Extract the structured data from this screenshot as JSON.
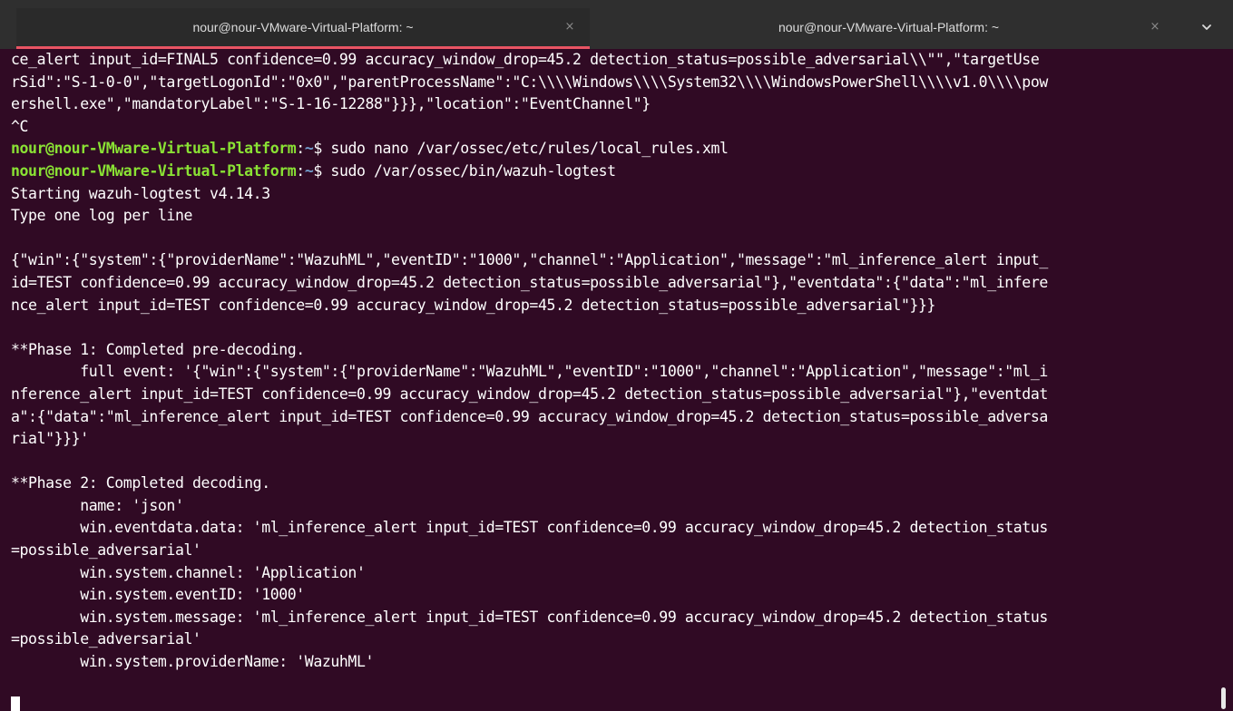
{
  "tabs": [
    {
      "title": "nour@nour-VMware-Virtual-Platform: ~",
      "active": true
    },
    {
      "title": "nour@nour-VMware-Virtual-Platform: ~",
      "active": false
    }
  ],
  "icons": {
    "close": "×",
    "menu": "chevron-down-icon"
  },
  "colors": {
    "background": "#300a24",
    "prompt_user": "#8ae234",
    "prompt_path": "#729fcf",
    "active_tab_indicator": "#e95463"
  },
  "prompt": {
    "user_host": "nour@nour-VMware-Virtual-Platform",
    "sep": ":",
    "path": "~",
    "symbol": "$"
  },
  "output_top": [
    "ce_alert input_id=FINAL5 confidence=0.99 accuracy_window_drop=45.2 detection_status=possible_adversarial\\\\\"\",\"targetUse",
    "rSid\":\"S-1-0-0\",\"targetLogonId\":\"0x0\",\"parentProcessName\":\"C:\\\\\\\\Windows\\\\\\\\System32\\\\\\\\WindowsPowerShell\\\\\\\\v1.0\\\\\\\\pow",
    "ershell.exe\",\"mandatoryLabel\":\"S-1-16-12288\"}}},\"location\":\"EventChannel\"}",
    "^C"
  ],
  "commands": [
    " sudo nano /var/ossec/etc/rules/local_rules.xml",
    " sudo /var/ossec/bin/wazuh-logtest"
  ],
  "output_bottom": [
    "Starting wazuh-logtest v4.14.3",
    "Type one log per line",
    "",
    "{\"win\":{\"system\":{\"providerName\":\"WazuhML\",\"eventID\":\"1000\",\"channel\":\"Application\",\"message\":\"ml_inference_alert input_",
    "id=TEST confidence=0.99 accuracy_window_drop=45.2 detection_status=possible_adversarial\"},\"eventdata\":{\"data\":\"ml_infere",
    "nce_alert input_id=TEST confidence=0.99 accuracy_window_drop=45.2 detection_status=possible_adversarial\"}}}",
    "",
    "**Phase 1: Completed pre-decoding.",
    "        full event: '{\"win\":{\"system\":{\"providerName\":\"WazuhML\",\"eventID\":\"1000\",\"channel\":\"Application\",\"message\":\"ml_i",
    "nference_alert input_id=TEST confidence=0.99 accuracy_window_drop=45.2 detection_status=possible_adversarial\"},\"eventdat",
    "a\":{\"data\":\"ml_inference_alert input_id=TEST confidence=0.99 accuracy_window_drop=45.2 detection_status=possible_adversa",
    "rial\"}}}'",
    "",
    "**Phase 2: Completed decoding.",
    "        name: 'json'",
    "        win.eventdata.data: 'ml_inference_alert input_id=TEST confidence=0.99 accuracy_window_drop=45.2 detection_status",
    "=possible_adversarial'",
    "        win.system.channel: 'Application'",
    "        win.system.eventID: '1000'",
    "        win.system.message: 'ml_inference_alert input_id=TEST confidence=0.99 accuracy_window_drop=45.2 detection_status",
    "=possible_adversarial'",
    "        win.system.providerName: 'WazuhML'",
    "",
    ""
  ]
}
